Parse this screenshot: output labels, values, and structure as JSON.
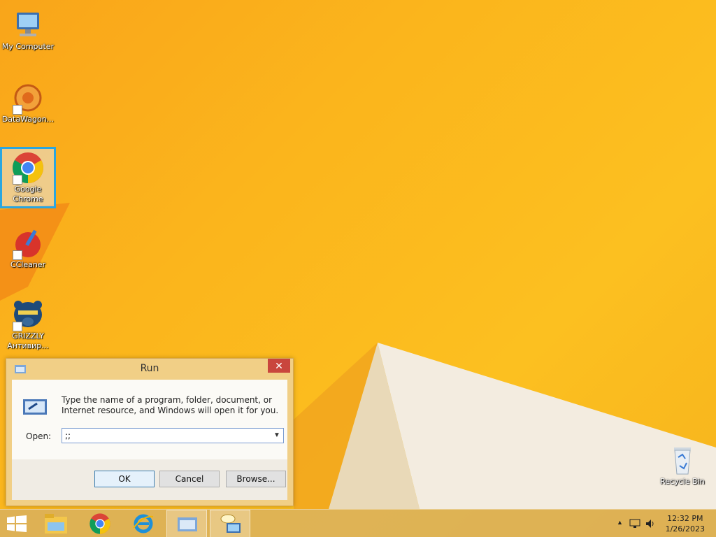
{
  "desktop": {
    "icons": [
      {
        "label": "My Computer",
        "icon": "computer-icon"
      },
      {
        "label": "DataWagon...",
        "icon": "datawagon-icon"
      },
      {
        "label": "Google Chrome",
        "icon": "chrome-icon",
        "selected": true
      },
      {
        "label": "CCleaner",
        "icon": "ccleaner-icon"
      },
      {
        "label": "GRIZZLY Антивир...",
        "icon": "grizzly-bear-icon"
      },
      {
        "label": "Recycle Bin",
        "icon": "recycle-bin-icon"
      }
    ]
  },
  "run_dialog": {
    "title": "Run",
    "close_glyph": "✕",
    "description": "Type the name of a program, folder, document, or Internet resource, and Windows will open it for you.",
    "open_label": "Open:",
    "open_value": ";;",
    "ok_label": "OK",
    "cancel_label": "Cancel",
    "browse_label": "Browse..."
  },
  "taskbar": {
    "items": [
      {
        "name": "start-button",
        "icon": "windows-logo-icon"
      },
      {
        "name": "file-explorer",
        "icon": "folder-icon"
      },
      {
        "name": "google-chrome",
        "icon": "chrome-icon"
      },
      {
        "name": "internet-explorer",
        "icon": "ie-icon"
      },
      {
        "name": "run-window-button",
        "icon": "run-icon",
        "active": true
      },
      {
        "name": "help-tool",
        "icon": "help-computer-icon",
        "active": true
      }
    ],
    "tray": {
      "show_hidden_glyph": "▲",
      "clock_time": "12:32 PM",
      "clock_date": "1/26/2023"
    }
  },
  "colors": {
    "wallpaper_orange": "#f9a51a",
    "wallpaper_dark_orange": "#f07d12",
    "selection_blue": "#2aa6e0",
    "dialog_frame": "#f1cf86",
    "close_red": "#c9463d"
  }
}
